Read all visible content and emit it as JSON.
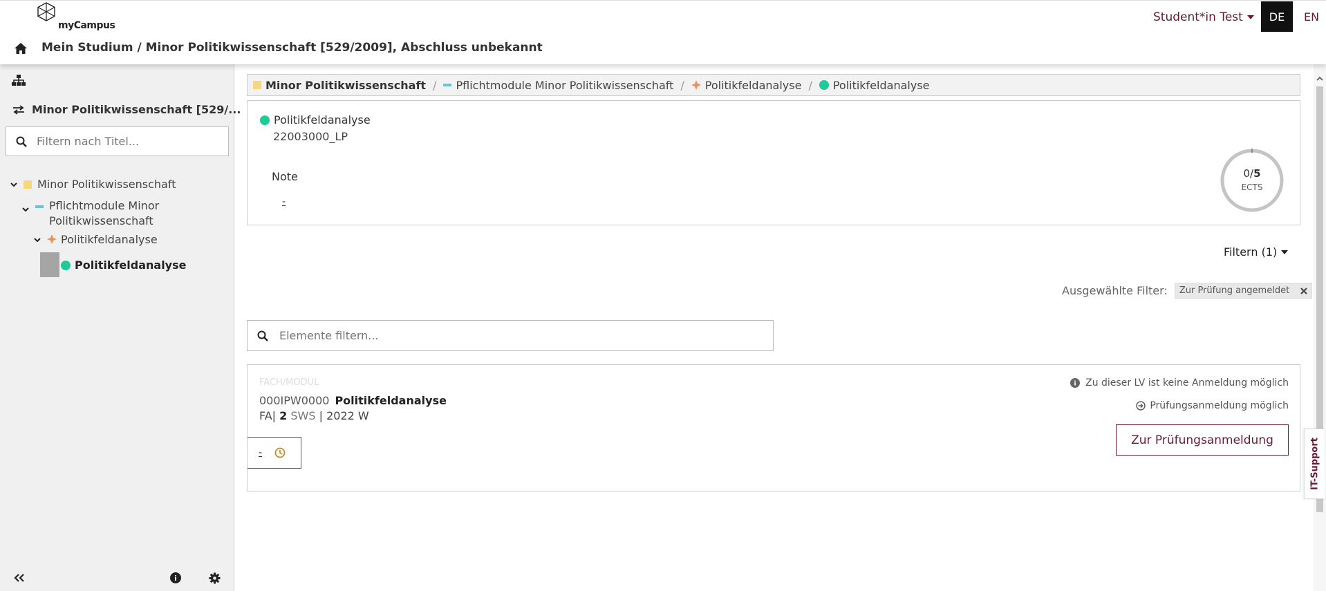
{
  "header": {
    "logo_text": "myCampus",
    "user_label": "Student*in Test",
    "lang_de": "DE",
    "lang_en": "EN",
    "page_title": "Mein Studium / Minor Politikwissenschaft [529/2009], Abschluss unbekannt"
  },
  "sidebar": {
    "switch_label": "Minor Politikwissenschaft [529/...",
    "search_placeholder": "Filtern nach Titel...",
    "tree": [
      {
        "label": "Minor Politikwissenschaft"
      },
      {
        "label_line1": "Pflichtmodule Minor",
        "label_line2": "Politikwissenschaft"
      },
      {
        "label": "Politikfeldanalyse"
      },
      {
        "label": "Politikfeldanalyse"
      }
    ]
  },
  "breadcrumb": {
    "items": [
      "Minor Politikwissenschaft",
      "Pflichtmodule Minor Politikwissenschaft",
      "Politikfeldanalyse",
      "Politikfeldanalyse"
    ],
    "separator": "/"
  },
  "module": {
    "title": "Politikfeldanalyse",
    "code": "22003000_LP",
    "note_label": "Note",
    "note_value": "-",
    "ects_value": "0/",
    "ects_total": "5",
    "ects_unit": "ECTS",
    "ects_progress": 0
  },
  "filters": {
    "button_label": "Filtern (1)",
    "selected_label": "Ausgewählte Filter:",
    "chip_label": "Zur Prüfung angemeldet"
  },
  "element_search": {
    "placeholder": "Elemente filtern..."
  },
  "course": {
    "type": "FACH/MODUL",
    "code": "000IPW0000",
    "title": "Politikfeldanalyse",
    "prefix": "FA|",
    "sws_value": "2",
    "sws_label": "SWS",
    "semester": "| 2022 W",
    "chip_value": "-",
    "info_no_registration": "Zu dieser LV ist keine Anmeldung möglich",
    "info_exam_possible": "Prüfungsanmeldung möglich",
    "exam_button": "Zur Prüfungsanmeldung"
  },
  "it_support": "IT-Support",
  "colors": {
    "brand": "#6b1a34",
    "module_yellow": "#f7d87e",
    "pflicht_blue": "#68c4de",
    "orange": "#e8925a",
    "green": "#1fc99a"
  }
}
